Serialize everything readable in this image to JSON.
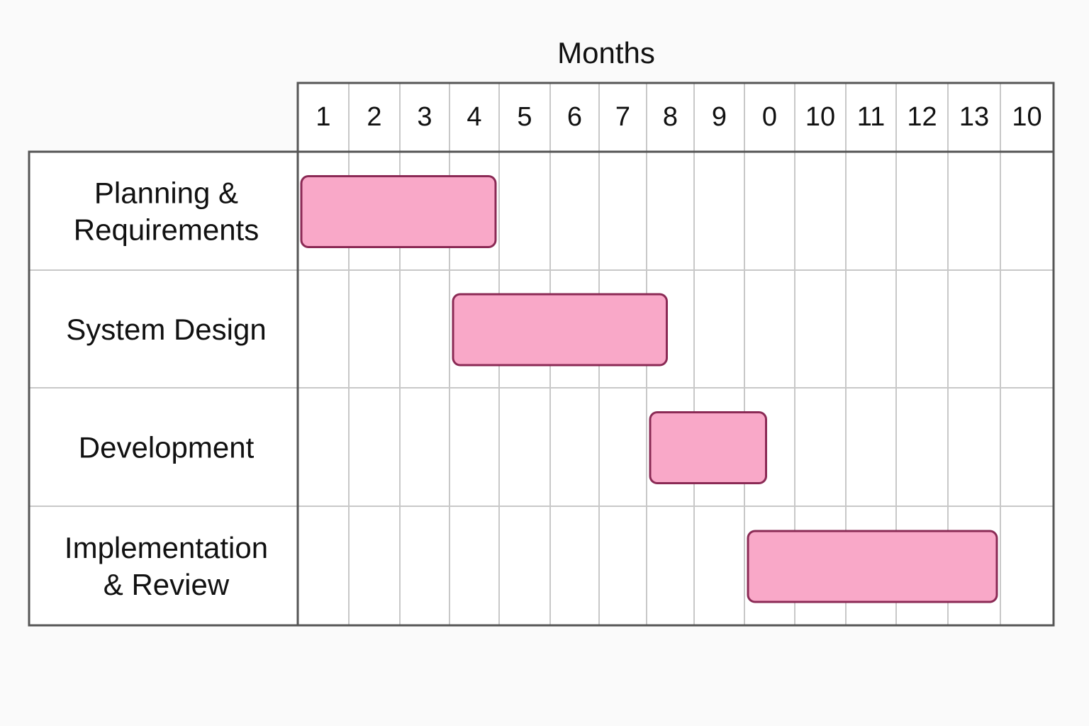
{
  "chart_data": {
    "type": "gantt",
    "xlabel": "Months",
    "ticks": [
      "1",
      "2",
      "3",
      "4",
      "5",
      "6",
      "7",
      "8",
      "9",
      "0",
      "10",
      "11",
      "12",
      "13",
      "10"
    ],
    "tasks": [
      {
        "label_lines": [
          "Planning &",
          "Requirements"
        ],
        "start": 1,
        "end": 5
      },
      {
        "label_lines": [
          "System Design"
        ],
        "start": 4,
        "end": 8.5
      },
      {
        "label_lines": [
          "Development"
        ],
        "start": 8,
        "end": 10.5
      },
      {
        "label_lines": [
          "Implementation",
          "& Review"
        ],
        "start": 10,
        "end": 15
      }
    ],
    "grid": true,
    "colors": {
      "bar_fill": "#f9a8c8",
      "bar_stroke": "#8b2a55",
      "frame": "#555555",
      "grid": "#c8c8c8",
      "text": "#111111",
      "background": "#fafafa"
    }
  }
}
